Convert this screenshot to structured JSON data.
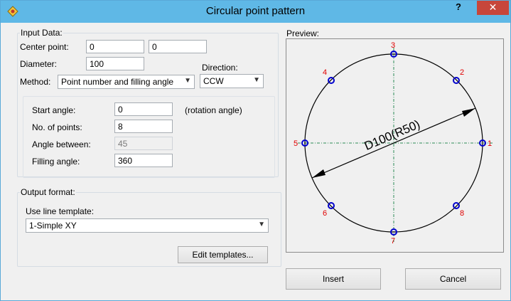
{
  "window": {
    "title": "Circular point pattern",
    "help_glyph": "?",
    "close_glyph": "✕"
  },
  "input_data": {
    "legend": "Input Data:",
    "center_label": "Center point:",
    "center_x": "0",
    "center_y": "0",
    "diameter_label": "Diameter:",
    "diameter": "100",
    "method_label": "Method:",
    "method_value": "Point number and filling angle",
    "direction_label": "Direction:",
    "direction_value": "CCW",
    "start_angle_label": "Start angle:",
    "start_angle": "0",
    "rotation_note": "(rotation angle)",
    "points_label": "No. of points:",
    "points": "8",
    "between_label": "Angle between:",
    "between": "45",
    "filling_label": "Filling angle:",
    "filling": "360"
  },
  "output_format": {
    "legend": "Output format:",
    "template_label": "Use line template:",
    "template_value": "1-Simple XY",
    "edit_button": "Edit templates..."
  },
  "preview": {
    "label": "Preview:",
    "dimension_text": "D100(R50)",
    "point_labels": [
      "1",
      "2",
      "3",
      "4",
      "5",
      "6",
      "7",
      "8"
    ],
    "colors": {
      "circle": "#000000",
      "points": "#0000cc",
      "labels": "#e00000",
      "centerline": "#2e8b57"
    }
  },
  "buttons": {
    "insert": "Insert",
    "cancel": "Cancel"
  }
}
